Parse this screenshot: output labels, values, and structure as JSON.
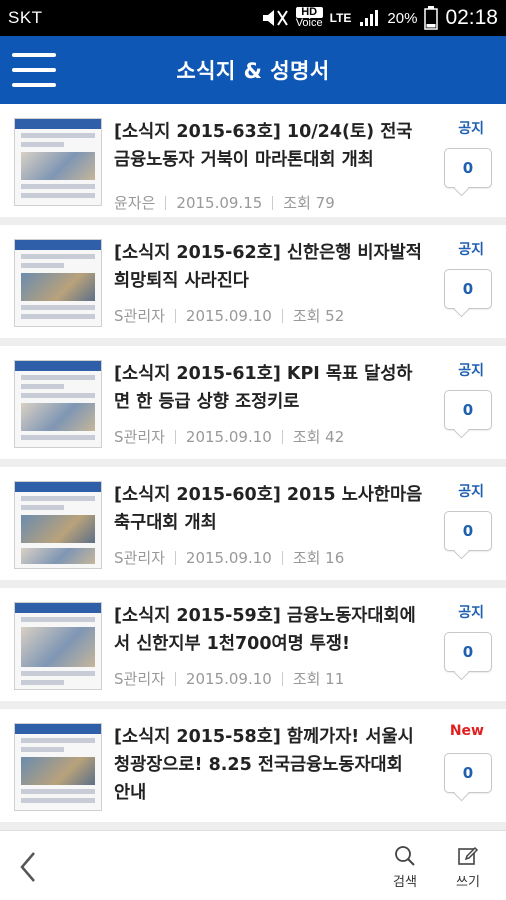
{
  "status_bar": {
    "carrier": "SKT",
    "hd_label": "HD",
    "voice_label": "Voice",
    "network": "LTE",
    "battery": "20%",
    "time": "02:18"
  },
  "app_bar": {
    "title": "소식지 & 성명서"
  },
  "posts": [
    {
      "title": "[소식지 2015-63호] 10/24(토) 전국금융노동자 거북이 마라톤대회 개최",
      "author": "윤자은",
      "date": "2015.09.15",
      "views": "조회 79",
      "badge": "공지",
      "comments": "0"
    },
    {
      "title": "[소식지 2015-62호] 신한은행 비자발적 희망퇴직 사라진다",
      "author": "S관리자",
      "date": "2015.09.10",
      "views": "조회 52",
      "badge": "공지",
      "comments": "0"
    },
    {
      "title": "[소식지 2015-61호] KPI 목표 달성하면 한 등급 상향 조정키로",
      "author": "S관리자",
      "date": "2015.09.10",
      "views": "조회 42",
      "badge": "공지",
      "comments": "0"
    },
    {
      "title": "[소식지 2015-60호] 2015 노사한마음 축구대회 개최",
      "author": "S관리자",
      "date": "2015.09.10",
      "views": "조회 16",
      "badge": "공지",
      "comments": "0"
    },
    {
      "title": "[소식지 2015-59호] 금융노동자대회에서 신한지부 1천700여명 투쟁!",
      "author": "S관리자",
      "date": "2015.09.10",
      "views": "조회 11",
      "badge": "공지",
      "comments": "0"
    },
    {
      "title": "[소식지 2015-58호] 함께가자! 서울시청광장으로! 8.25 전국금융노동자대회 안내",
      "author": "",
      "date": "",
      "views": "",
      "badge": "New",
      "comments": "0"
    }
  ],
  "bottom_bar": {
    "search_label": "검색",
    "write_label": "쓰기"
  },
  "colors": {
    "app_bar": "#0e57b5",
    "notice_badge": "#1f5fb0",
    "new_badge": "#e02020"
  },
  "icons": {
    "menu": "hamburger-icon",
    "back": "chevron-left-icon",
    "search": "search-icon",
    "write": "edit-icon"
  }
}
